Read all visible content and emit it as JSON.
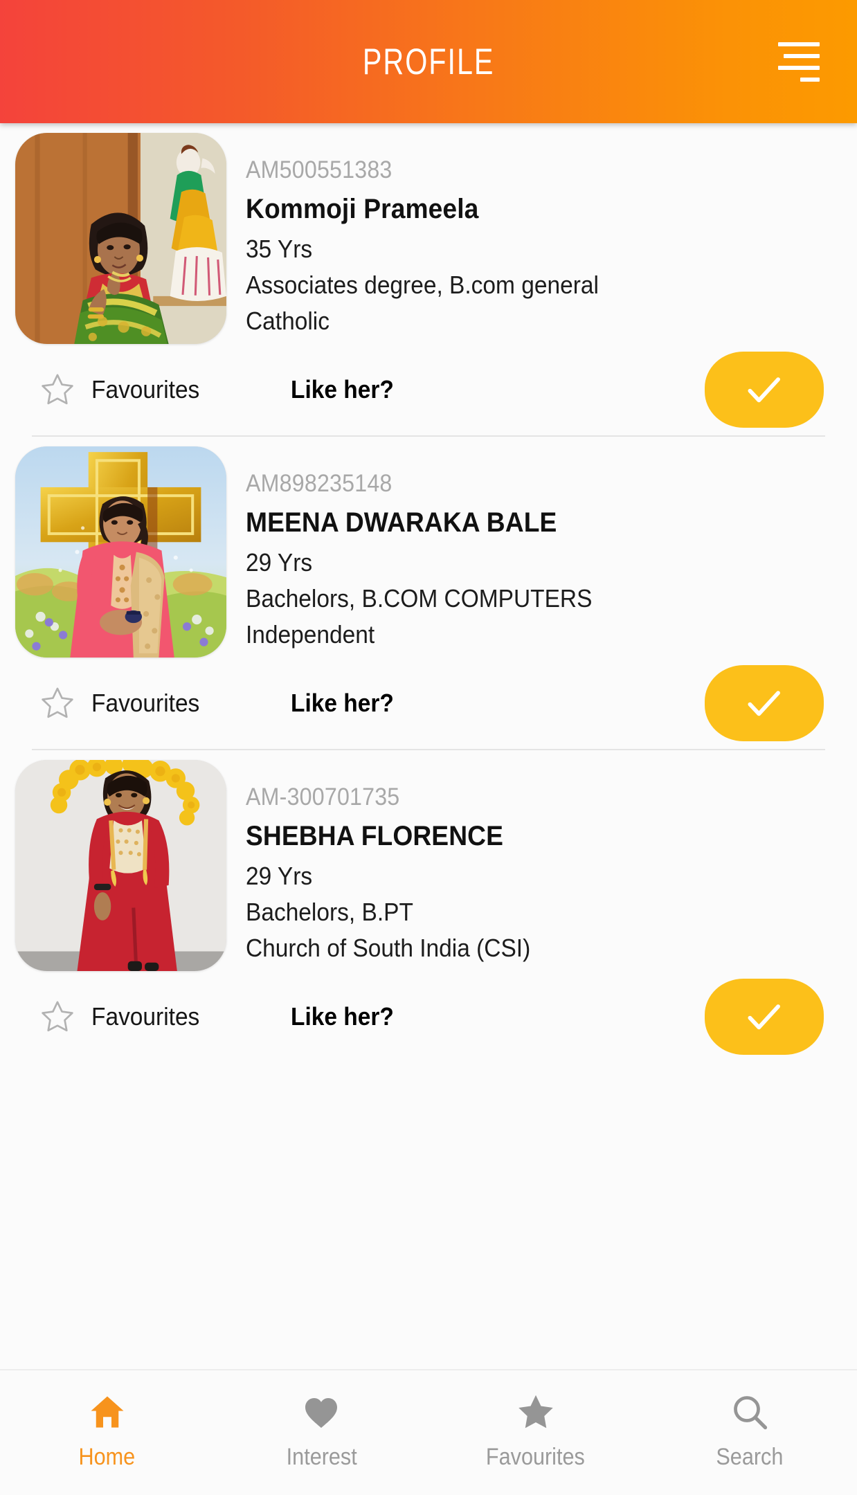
{
  "header": {
    "title": "PROFILE",
    "menu_icon": "hamburger-menu-icon",
    "gradient_start": "#F4433B",
    "gradient_end": "#FC9A00"
  },
  "list": {
    "action_labels": {
      "favourites": "Favourites",
      "like": "Like her?",
      "check_icon": "check-icon"
    },
    "accent_button_color": "#FCC01A",
    "profiles": [
      {
        "id": "AM500551383",
        "name": "Kommoji Prameela",
        "age": "35 Yrs",
        "education": "Associates degree, B.com general",
        "religion": "Catholic",
        "photo_alt": "woman-in-green-saree-beside-wooden-door-with-statue"
      },
      {
        "id": "AM898235148",
        "name": "MEENA DWARAKA BALE",
        "age": "29 Yrs",
        "education": "Bachelors, B.COM COMPUTERS",
        "religion": "Independent",
        "photo_alt": "woman-in-pink-kurta-before-golden-cross-backdrop"
      },
      {
        "id": "AM-300701735",
        "name": "SHEBHA FLORENCE",
        "age": "29 Yrs",
        "education": "Bachelors, B.PT",
        "religion": "Church of South India (CSI)",
        "photo_alt": "woman-in-red-kurta-with-marigold-garlands"
      }
    ]
  },
  "bottomnav": {
    "active_color": "#F7931D",
    "inactive_color": "#9A9A9A",
    "items": [
      {
        "label": "Home",
        "icon": "home-icon",
        "active": true
      },
      {
        "label": "Interest",
        "icon": "heart-icon",
        "active": false
      },
      {
        "label": "Favourites",
        "icon": "star-icon",
        "active": false
      },
      {
        "label": "Search",
        "icon": "search-icon",
        "active": false
      }
    ]
  }
}
